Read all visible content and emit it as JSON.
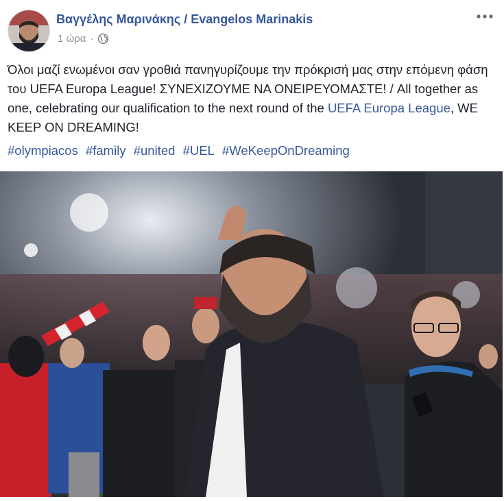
{
  "post": {
    "author": "Βαγγέλης Μαρινάκης / Evangelos Marinakis",
    "time": "1 ώρα",
    "privacy_icon": "globe-icon",
    "more_icon": "more-options-icon",
    "text_part1": "Όλοι μαζί ενωμένοι σαν γροθιά πανηγυρίζουμε την πρόκρισή μας στην επόμενη φάση του UEFA Europa League! ΣΥΝΕΧΙΖΟΥΜΕ ΝΑ ΟΝΕΙΡΕΥΟΜΑΣΤΕ! / All together as one, celebrating our qualification to the next round of the ",
    "text_link": "UEFA Europa League",
    "text_part2": ", WE KEEP ON DREAMING!",
    "hashtags": [
      "#olympiacos",
      "#family",
      "#united",
      "#UEL",
      "#WeKeepOnDreaming"
    ]
  },
  "colors": {
    "link": "#365899",
    "meta": "#90949c",
    "text": "#1d2129"
  }
}
